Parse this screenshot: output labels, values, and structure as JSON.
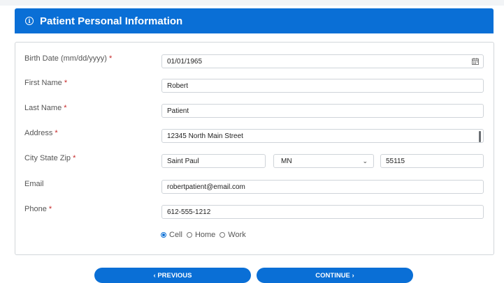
{
  "header": {
    "title": "Patient Personal Information",
    "icon": "info-icon"
  },
  "form": {
    "birth_date": {
      "label": "Birth Date (mm/dd/yyyy)",
      "required": "*",
      "value": "01/01/1965",
      "icon": "calendar-icon"
    },
    "first_name": {
      "label": "First Name",
      "required": "*",
      "value": "Robert"
    },
    "last_name": {
      "label": "Last Name",
      "required": "*",
      "value": "Patient"
    },
    "address": {
      "label": "Address",
      "required": "*",
      "value": "12345 North Main Street"
    },
    "city_state_zip": {
      "label": "City State Zip",
      "required": "*",
      "city": "Saint Paul",
      "state": "MN",
      "zip": "55115"
    },
    "email": {
      "label": "Email",
      "value": "robertpatient@email.com"
    },
    "phone": {
      "label": "Phone",
      "required": "*",
      "value": "612-555-1212"
    },
    "phone_type": {
      "options": [
        "Cell",
        "Home",
        "Work"
      ],
      "selected": "Cell"
    }
  },
  "buttons": {
    "previous": "‹ PREVIOUS",
    "continue": "CONTINUE ›"
  },
  "colors": {
    "accent": "#0a6fd6",
    "required": "#c62828"
  }
}
